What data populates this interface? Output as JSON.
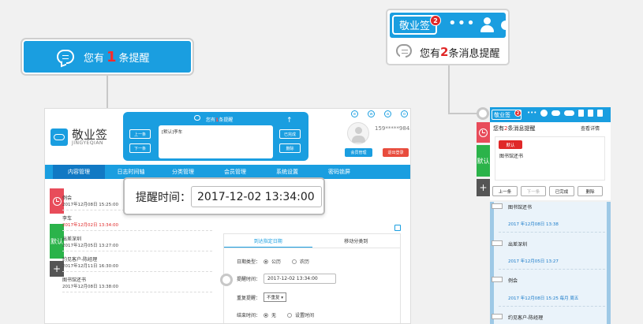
{
  "callout_main": {
    "prefix": "您有",
    "count": "1",
    "suffix": "条提醒"
  },
  "callout_widget": {
    "tag": "敬业签",
    "badge": "2",
    "prefix": "您有",
    "count": "2",
    "suffix": "条消息提醒"
  },
  "app": {
    "name": "敬业签",
    "sub": "JINGYEQIAN",
    "phone": "159*****9845",
    "reminder_panel": {
      "title_prefix": "您有",
      "title_count": "1",
      "title_suffix": "条提醒",
      "prev": "上一条",
      "next": "下一条",
      "note": "[默认]李车",
      "done": "已完成",
      "delete": "删除",
      "arrow": "↑"
    },
    "header_icons": [
      "e",
      "w",
      "a",
      "o"
    ],
    "member_button": "会员管理",
    "logout_button": "退出登录",
    "nav": [
      "内容管理",
      "日志时间轴",
      "分类管理",
      "会员管理",
      "系统设置",
      "密码锁屏"
    ],
    "side_tag": "默认",
    "plus": "+",
    "list": [
      {
        "title": "例会",
        "date": "2017年12月08日 15:25:00",
        "red": false
      },
      {
        "title": "李车",
        "date": "2017年12月02日 13:34:00",
        "red": true
      },
      {
        "title": "出差深圳",
        "date": "2017年12月05日 13:27:00",
        "red": false
      },
      {
        "title": "约见客户-陈经理",
        "date": "2017年12月11日 16:30:00",
        "red": false
      },
      {
        "title": "图书馆还书",
        "date": "2017年12月08日 13:38:00",
        "red": false
      }
    ],
    "form": {
      "tab_active": "到达指定日期",
      "tab_other": "移动分类到",
      "date_type_label": "日期类型：",
      "gregorian": "公历",
      "lunar": "农历",
      "time_label": "提醒时间：",
      "time_value": "2017-12-02 13:34:00",
      "repeat_label": "重复提醒：",
      "repeat_value": "不重复 ▾",
      "end_label": "结束时间：",
      "none": "无",
      "set_time": "设置时间"
    }
  },
  "popup": {
    "label": "提醒时间：",
    "value": "2017-12-02 13:34:00"
  },
  "widget": {
    "tag": "敬业签",
    "badge": "2",
    "head_prefix": "您有",
    "head_count": "2",
    "head_suffix": "条消息提醒",
    "detail": "查看详情",
    "pill": "默认",
    "note": "图书馆还书",
    "side_tag": "默认",
    "plus": "+",
    "buttons": [
      "上一条",
      "下一条",
      "已完成",
      "删除"
    ],
    "list": [
      {
        "title": "图书馆还书",
        "date": "2017 年12月08日 13:38"
      },
      {
        "title": "出差深圳",
        "date": "2017 年12月05日 13:27"
      },
      {
        "title": "例会",
        "date": "2017 年12月08日 15:25 每月 周五"
      },
      {
        "title": "约见客户-陈经理",
        "date": ""
      }
    ]
  },
  "colors": {
    "accent": "#1a9ee0",
    "red": "#e02828",
    "green": "#2bb34a",
    "dark": "#555555"
  }
}
